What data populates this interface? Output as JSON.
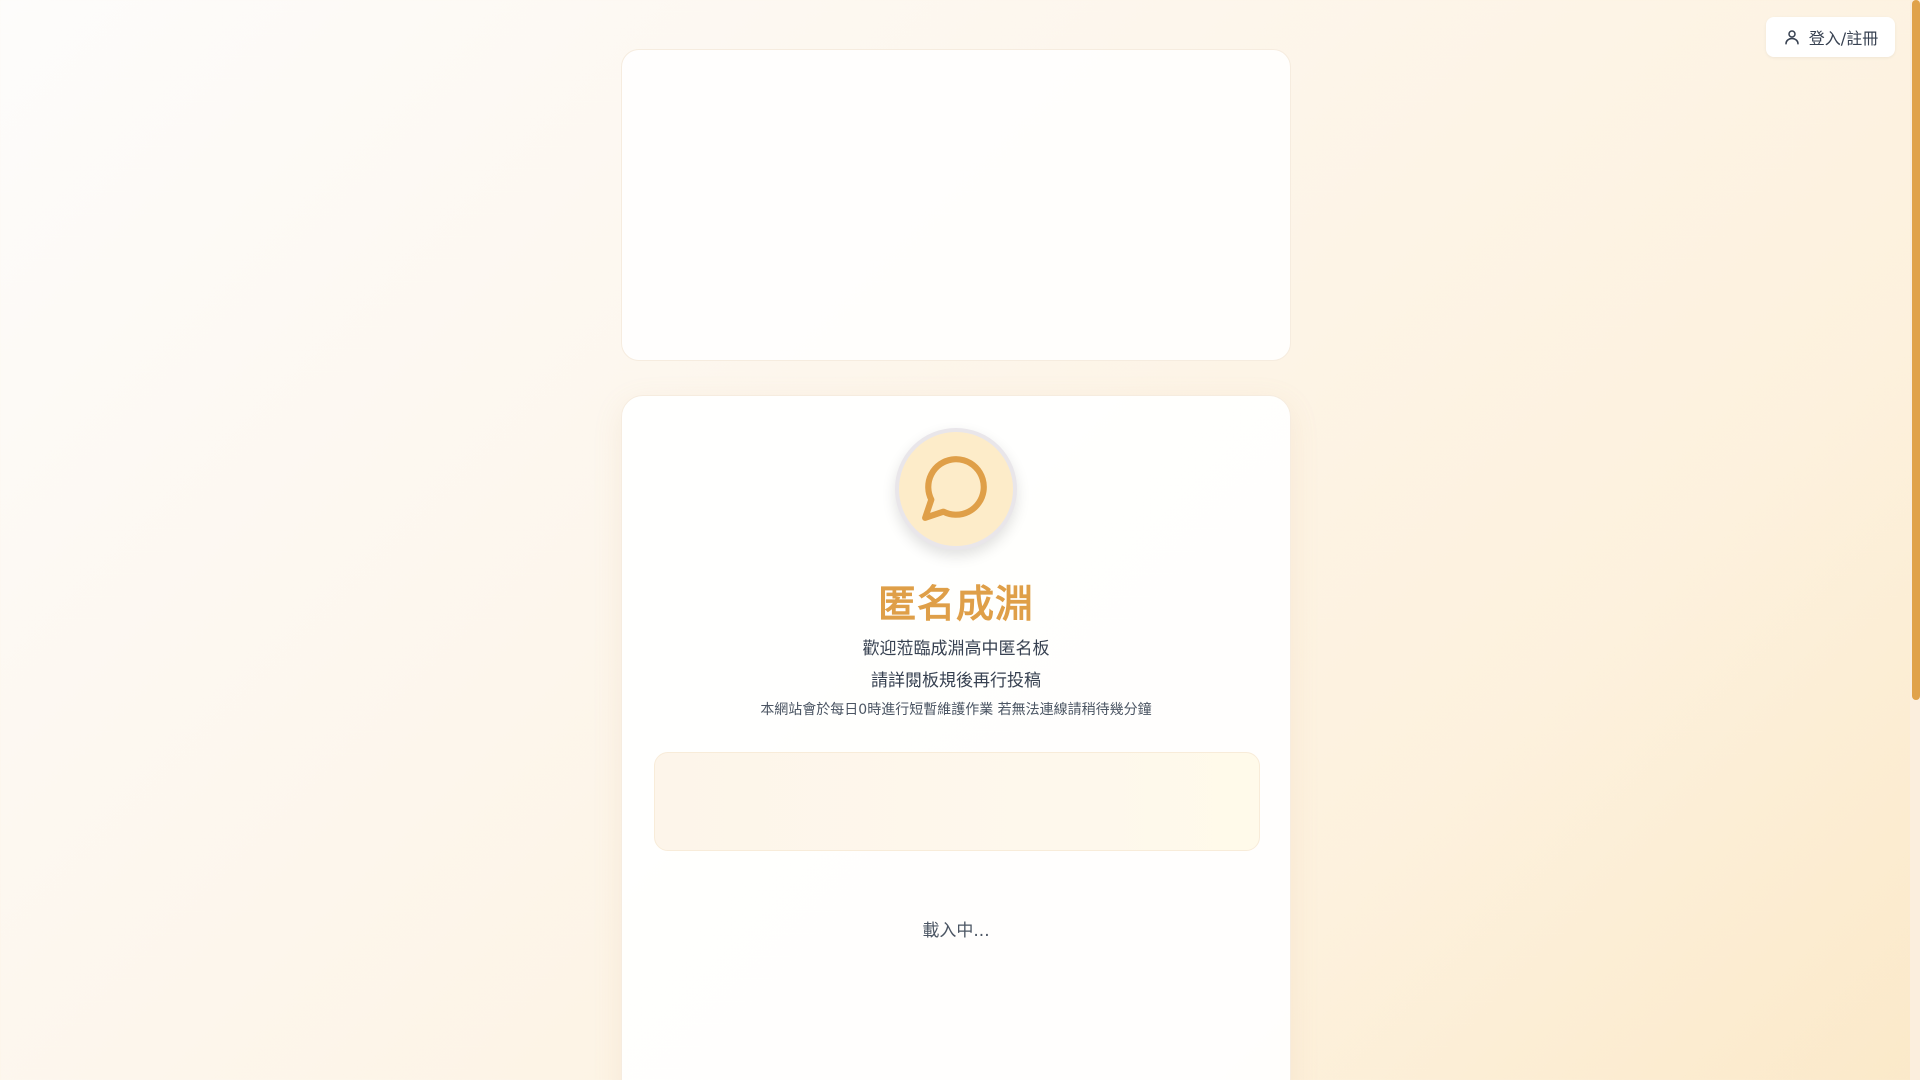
{
  "header": {
    "login_label": "登入/註冊",
    "login_icon": "user-icon"
  },
  "board": {
    "logo_icon": "chat-bubble-icon",
    "title": "匿名成淵",
    "welcome": "歡迎蒞臨成淵高中匿名板",
    "rules_hint": "請詳閱板規後再行投稿",
    "maintenance_notice": "本網站會於每日0時進行短暫維護作業 若無法連線請稍待幾分鐘",
    "loading_text": "載入中..."
  },
  "colors": {
    "accent": "#df9f48",
    "logo_bg": "#fdecc9",
    "scrollbar": "#e0a24b"
  }
}
